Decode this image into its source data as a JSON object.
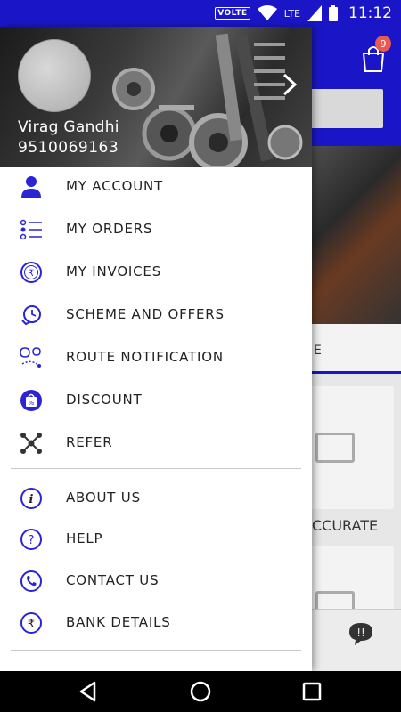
{
  "status_bar": {
    "volte": "VOLTE",
    "network": "LTE",
    "time": "11:12"
  },
  "app": {
    "cart_badge": "9",
    "tab_partial": "E",
    "card_label_partial": "CCURATE"
  },
  "drawer": {
    "user_name": "Virag Gandhi",
    "user_phone": "9510069163",
    "menu_items": [
      {
        "label": "MY ACCOUNT",
        "icon": "person-icon"
      },
      {
        "label": "MY ORDERS",
        "icon": "list-icon"
      },
      {
        "label": "MY INVOICES",
        "icon": "rupee-circle-icon"
      },
      {
        "label": "SCHEME AND OFFERS",
        "icon": "clock-offer-icon"
      },
      {
        "label": "ROUTE NOTIFICATION",
        "icon": "route-icon"
      },
      {
        "label": "DISCOUNT",
        "icon": "discount-bag-icon"
      },
      {
        "label": "REFER",
        "icon": "share-network-icon"
      }
    ],
    "secondary_items": [
      {
        "label": "ABOUT US",
        "icon": "info-icon"
      },
      {
        "label": "HELP",
        "icon": "help-icon"
      },
      {
        "label": "CONTACT US",
        "icon": "phone-icon"
      },
      {
        "label": "BANK DETAILS",
        "icon": "rupee-icon"
      }
    ]
  },
  "colors": {
    "primary": "#1a16c8",
    "icon": "#2a24d6",
    "badge": "#e85a4f"
  }
}
